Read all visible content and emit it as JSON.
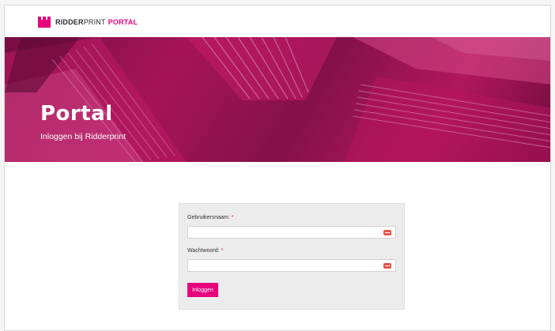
{
  "header": {
    "logo_brand": "RIDDER",
    "logo_print": "PRINT",
    "logo_portal": "PORTAL"
  },
  "hero": {
    "title": "Portal",
    "subtitle": "Inloggen bij Ridderprint"
  },
  "login_form": {
    "username_label": "Gebruikersnaam:",
    "username_value": "",
    "password_label": "Wachtwoord:",
    "password_value": "",
    "required_marker": "*",
    "submit_label": "Inloggen"
  },
  "colors": {
    "brand": "#e6007e",
    "key_icon": "#e4554a",
    "form_background": "#ececec"
  },
  "icons": {
    "logo": "castle-crown-icon",
    "field_icon": "key-icon"
  }
}
